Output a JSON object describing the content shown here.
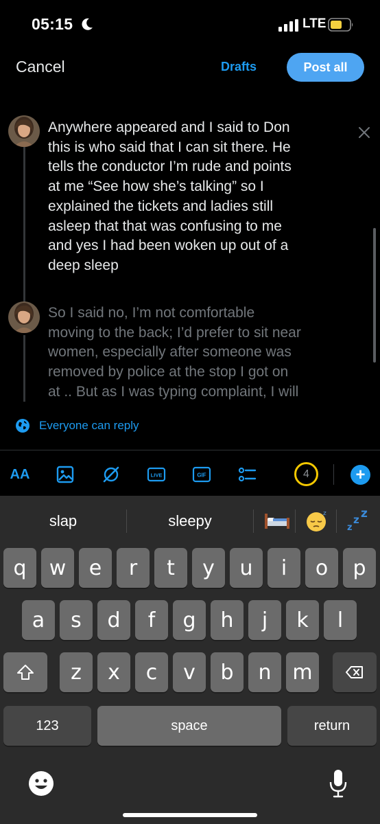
{
  "status_bar": {
    "time": "05:15",
    "network": "LTE"
  },
  "header": {
    "cancel_label": "Cancel",
    "drafts_label": "Drafts",
    "post_all_label": "Post all"
  },
  "thread": {
    "posts": [
      {
        "lines": [
          "Anywhere appeared and I said to Don",
          "this is who said that I can sit there. He",
          "tells the conductor I’m rude and points",
          "at me “See how she’s talking” so I",
          "explained the tickets and ladies still",
          "asleep that that was confusing to me",
          "and yes I had been woken up out of a",
          "deep sleep"
        ]
      },
      {
        "lines": [
          "So I said no, I’m not comfortable",
          "moving to the back; I’d prefer to sit near",
          "women, especially after someone was",
          "removed by police at the stop I got on",
          "at .. But as I was typing complaint, I will"
        ]
      }
    ]
  },
  "reply_settings": {
    "label": "Everyone can reply"
  },
  "toolbar": {
    "text_style_label": "AA",
    "live_label": "LIVE",
    "gif_label": "GIF",
    "remaining_count": "4",
    "add_label": "+"
  },
  "keyboard": {
    "suggestions": [
      "slap",
      "sleepy"
    ],
    "emoji_suggestions": [
      "bed-emoji",
      "sleepy-face-emoji",
      "zzz-emoji"
    ],
    "row1": [
      "q",
      "w",
      "e",
      "r",
      "t",
      "y",
      "u",
      "i",
      "o",
      "p"
    ],
    "row2": [
      "a",
      "s",
      "d",
      "f",
      "g",
      "h",
      "j",
      "k",
      "l"
    ],
    "row3": [
      "z",
      "x",
      "c",
      "v",
      "b",
      "n",
      "m"
    ],
    "numbers_label": "123",
    "space_label": "space",
    "return_label": "return"
  }
}
